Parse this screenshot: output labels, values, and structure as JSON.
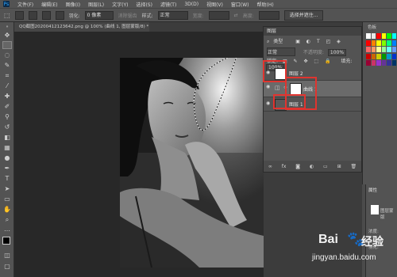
{
  "app": {
    "logo": "Ps"
  },
  "menu": [
    "文件(F)",
    "编辑(E)",
    "图像(I)",
    "图层(L)",
    "文字(Y)",
    "选择(S)",
    "滤镜(T)",
    "3D(D)",
    "视图(V)",
    "窗口(W)",
    "帮助(H)"
  ],
  "options": {
    "feather_label": "羽化:",
    "feather_value": "0 像素",
    "antialias_label": "消除锯齿",
    "style_label": "样式:",
    "style_value": "正常",
    "width_label": "宽度:",
    "height_label": "高度:",
    "select_mask_label": "选择并遮住..."
  },
  "document": {
    "tab_title": "QQ截图20200412123642.png @ 100% (曲线 1, 图层蒙版/8) *",
    "close": "×"
  },
  "layers": {
    "panel_title": "图层",
    "filter_label": "类型",
    "blend_mode": "正常",
    "opacity_label": "不透明度:",
    "opacity_value": "100%",
    "lock_label": "锁定:",
    "fill_label": "填充:",
    "fill_value": "100%",
    "items": [
      {
        "name": "图层 2"
      },
      {
        "name": "曲线 1"
      },
      {
        "name": "图层 1"
      }
    ],
    "footer_icons": [
      "link-icon",
      "fx-icon",
      "mask-icon",
      "adjustment-icon",
      "folder-icon",
      "new-layer-icon",
      "trash-icon"
    ]
  },
  "properties": {
    "title": "属性",
    "mask_label": "图层蒙版",
    "density_label": "浓度:",
    "feather_label": "羽化:"
  },
  "watermark": {
    "brand": "Bai",
    "brand2": "经验",
    "url": "jingyan.baidu.com"
  },
  "swatch_colors": [
    "#ffffff",
    "#e8e8e8",
    "#ff0000",
    "#ffff00",
    "#00ff00",
    "#00ffff",
    "#ff0000",
    "#ff8000",
    "#ffff00",
    "#80ff00",
    "#00ff80",
    "#0080ff",
    "#ff6666",
    "#ff9966",
    "#ffff99",
    "#99ff99",
    "#66ffff",
    "#6699ff",
    "#cc0000",
    "#cc6600",
    "#cccc00",
    "#009900",
    "#0099cc",
    "#0033cc",
    "#990033",
    "#cc3366",
    "#9933cc",
    "#663399",
    "#333399",
    "#003366"
  ]
}
